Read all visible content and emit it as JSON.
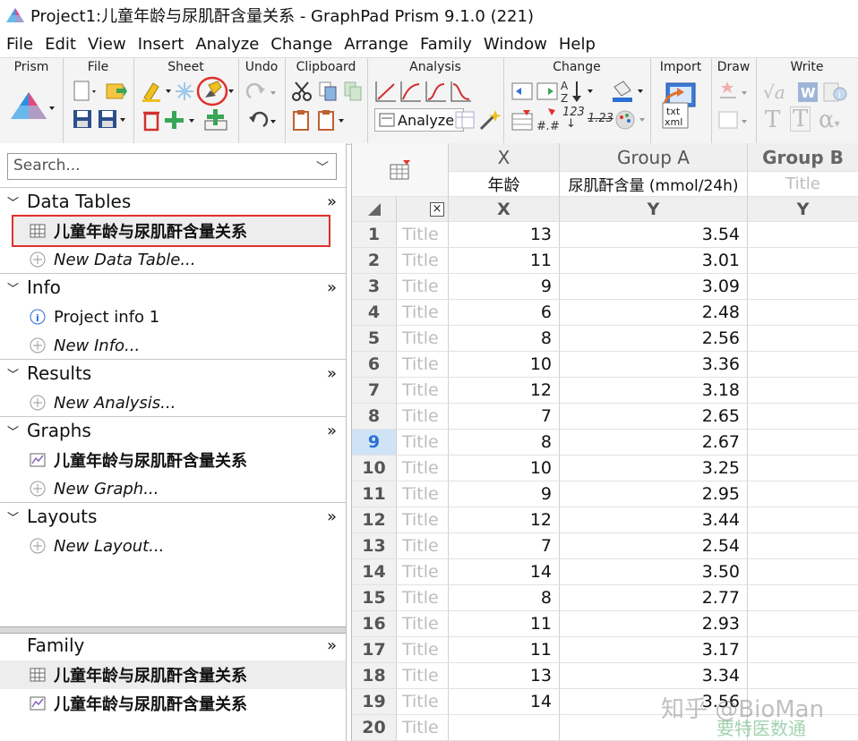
{
  "window": {
    "title": "Project1:儿童年龄与尿肌酐含量关系 - GraphPad Prism 9.1.0 (221)"
  },
  "menu": [
    "File",
    "Edit",
    "View",
    "Insert",
    "Analyze",
    "Change",
    "Arrange",
    "Family",
    "Window",
    "Help"
  ],
  "ribbon": {
    "groups": [
      "Prism",
      "File",
      "Sheet",
      "Undo",
      "Clipboard",
      "Analysis",
      "Change",
      "Import",
      "Draw",
      "Write"
    ],
    "analyze_label": "Analyze",
    "change_123": "123",
    "change_123b": "1.23",
    "import_txt": "txt",
    "import_xml": "xml"
  },
  "navigator": {
    "search_placeholder": "Search...",
    "sections": [
      {
        "label": "Data Tables",
        "items": [
          {
            "label": "儿童年龄与尿肌酐含量关系",
            "icon": "table-icon"
          },
          {
            "label": "New Data Table...",
            "icon": "plus-circle-icon"
          }
        ]
      },
      {
        "label": "Info",
        "items": [
          {
            "label": "Project info 1",
            "icon": "info-icon"
          },
          {
            "label": "New Info...",
            "icon": "plus-circle-icon"
          }
        ]
      },
      {
        "label": "Results",
        "items": [
          {
            "label": "New Analysis...",
            "icon": "plus-circle-icon"
          }
        ]
      },
      {
        "label": "Graphs",
        "items": [
          {
            "label": "儿童年龄与尿肌酐含量关系",
            "icon": "graph-icon"
          },
          {
            "label": "New Graph...",
            "icon": "plus-circle-icon"
          }
        ]
      },
      {
        "label": "Layouts",
        "items": [
          {
            "label": "New Layout...",
            "icon": "plus-circle-icon"
          }
        ]
      }
    ],
    "family": {
      "label": "Family",
      "items": [
        {
          "label": "儿童年龄与尿肌酐含量关系",
          "icon": "table-icon"
        },
        {
          "label": "儿童年龄与尿肌酐含量关系",
          "icon": "graph-icon"
        }
      ]
    },
    "more": "»"
  },
  "sheet": {
    "col_x": {
      "group": "X",
      "title": "年龄",
      "sub": "X"
    },
    "col_a": {
      "group": "Group A",
      "title": "尿肌酐含量 (mmol/24h)",
      "sub": "Y"
    },
    "col_b": {
      "group": "Group B",
      "title": "Title",
      "sub": "Y"
    },
    "row_title": "Title",
    "close": "×",
    "rows": [
      {
        "n": "1",
        "x": "13",
        "y": "3.54"
      },
      {
        "n": "2",
        "x": "11",
        "y": "3.01"
      },
      {
        "n": "3",
        "x": "9",
        "y": "3.09"
      },
      {
        "n": "4",
        "x": "6",
        "y": "2.48"
      },
      {
        "n": "5",
        "x": "8",
        "y": "2.56"
      },
      {
        "n": "6",
        "x": "10",
        "y": "3.36"
      },
      {
        "n": "7",
        "x": "12",
        "y": "3.18"
      },
      {
        "n": "8",
        "x": "7",
        "y": "2.65"
      },
      {
        "n": "9",
        "x": "8",
        "y": "2.67"
      },
      {
        "n": "10",
        "x": "10",
        "y": "3.25"
      },
      {
        "n": "11",
        "x": "9",
        "y": "2.95"
      },
      {
        "n": "12",
        "x": "12",
        "y": "3.44"
      },
      {
        "n": "13",
        "x": "7",
        "y": "2.54"
      },
      {
        "n": "14",
        "x": "14",
        "y": "3.50"
      },
      {
        "n": "15",
        "x": "8",
        "y": "2.77"
      },
      {
        "n": "16",
        "x": "11",
        "y": "2.93"
      },
      {
        "n": "17",
        "x": "11",
        "y": "3.17"
      },
      {
        "n": "18",
        "x": "13",
        "y": "3.34"
      },
      {
        "n": "19",
        "x": "14",
        "y": "3.56"
      },
      {
        "n": "20",
        "x": "",
        "y": ""
      }
    ],
    "active_row": "9"
  },
  "watermark": {
    "line1": "知乎 @BioMan",
    "line2": "要特医数通"
  },
  "colors": {
    "accent": "#2a6fd6",
    "highlight": "#e0302a"
  }
}
